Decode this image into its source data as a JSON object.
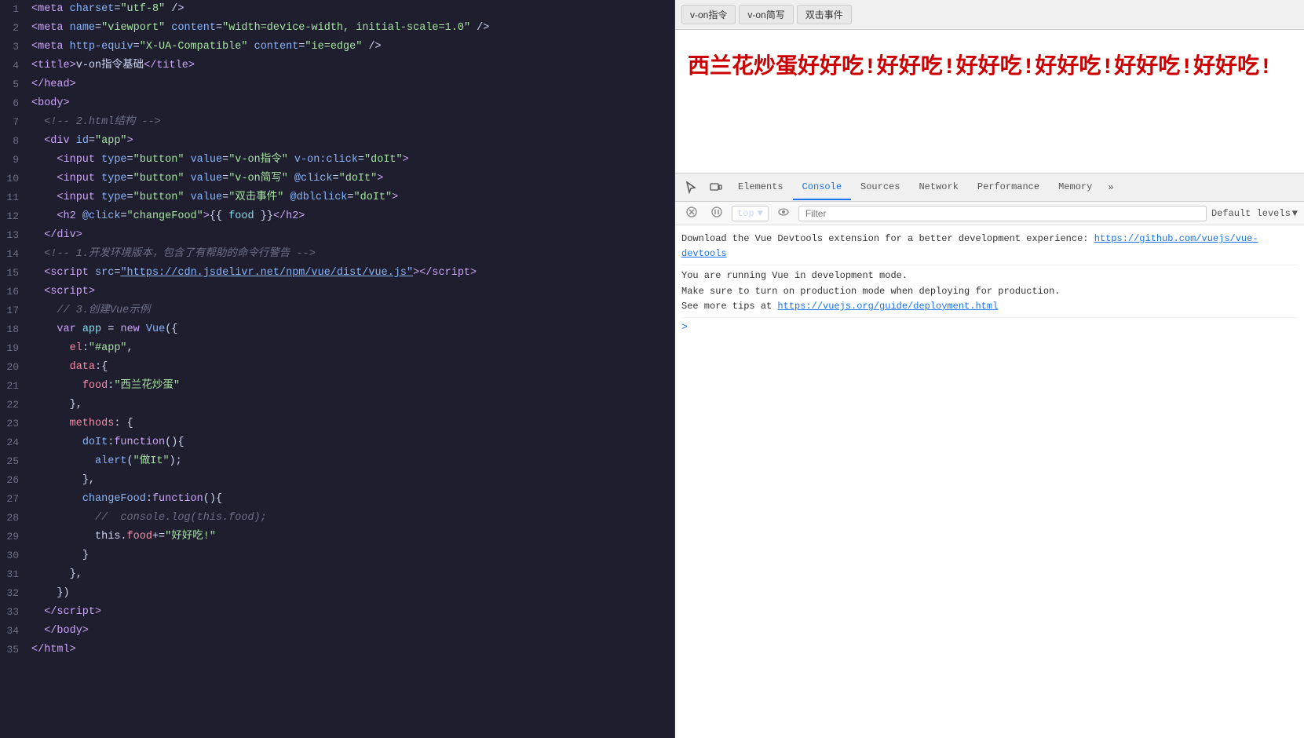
{
  "editor": {
    "lines": [
      {
        "num": 1,
        "html": "<span class='tag'>&lt;meta</span> <span class='attr-name'>charset</span><span class='punctuation'>=</span><span class='string'>\"utf-8\"</span> <span class='punctuation'>/&gt;</span>"
      },
      {
        "num": 2,
        "html": "<span class='tag'>&lt;meta</span> <span class='attr-name'>name</span><span class='punctuation'>=</span><span class='string'>\"viewport\"</span> <span class='attr-name'>content</span><span class='punctuation'>=</span><span class='string'>\"width=device-width, initial-scale=1.0\"</span> <span class='punctuation'>/&gt;</span>"
      },
      {
        "num": 3,
        "html": "<span class='tag'>&lt;meta</span> <span class='attr-name'>http-equiv</span><span class='punctuation'>=</span><span class='string'>\"X-UA-Compatible\"</span> <span class='attr-name'>content</span><span class='punctuation'>=</span><span class='string'>\"ie=edge\"</span> <span class='punctuation'>/&gt;</span>"
      },
      {
        "num": 4,
        "html": "<span class='tag'>&lt;title&gt;</span><span class='white'>v-on指令基础</span><span class='tag'>&lt;/title&gt;</span>"
      },
      {
        "num": 5,
        "html": "<span class='tag'>&lt;/head&gt;</span>"
      },
      {
        "num": 6,
        "html": "<span class='tag'>&lt;body&gt;</span>"
      },
      {
        "num": 7,
        "html": "  <span class='comment'>&lt;!-- 2.html结构 --&gt;</span>"
      },
      {
        "num": 8,
        "html": "  <span class='tag'>&lt;div</span> <span class='attr-name'>id</span><span class='punctuation'>=</span><span class='string'>\"app\"</span><span class='tag'>&gt;</span>"
      },
      {
        "num": 9,
        "html": "    <span class='tag'>&lt;input</span> <span class='attr-name'>type</span><span class='punctuation'>=</span><span class='string'>\"button\"</span> <span class='attr-name'>value</span><span class='punctuation'>=</span><span class='string'>\"v-on指令\"</span> <span class='attr-name'>v-on:click</span><span class='punctuation'>=</span><span class='string'>\"doIt\"</span><span class='tag'>&gt;</span>"
      },
      {
        "num": 10,
        "html": "    <span class='tag'>&lt;input</span> <span class='attr-name'>type</span><span class='punctuation'>=</span><span class='string'>\"button\"</span> <span class='attr-name'>value</span><span class='punctuation'>=</span><span class='string'>\"v-on简写\"</span> <span class='attr-name'>@click</span><span class='punctuation'>=</span><span class='string'>\"doIt\"</span><span class='tag'>&gt;</span>"
      },
      {
        "num": 11,
        "html": "    <span class='tag'>&lt;input</span> <span class='attr-name'>type</span><span class='punctuation'>=</span><span class='string'>\"button\"</span> <span class='attr-name'>value</span><span class='punctuation'>=</span><span class='string'>\"双击事件\"</span> <span class='attr-name'>@dblclick</span><span class='punctuation'>=</span><span class='string'>\"doIt\"</span><span class='tag'>&gt;</span>"
      },
      {
        "num": 12,
        "html": "    <span class='tag'>&lt;h2</span> <span class='attr-name'>@click</span><span class='punctuation'>=</span><span class='string'>\"changeFood\"</span><span class='tag'>&gt;</span><span class='punctuation'>{{</span> <span class='var-name'>food</span> <span class='punctuation'>}}</span><span class='tag'>&lt;/h2&gt;</span>"
      },
      {
        "num": 13,
        "html": "  <span class='tag'>&lt;/div&gt;</span>"
      },
      {
        "num": 14,
        "html": "  <span class='comment'>&lt;!-- 1.开发环境版本，包含了有帮助的命令行警告 --&gt;</span>"
      },
      {
        "num": 15,
        "html": "  <span class='tag'>&lt;script</span> <span class='attr-name'>src</span><span class='punctuation'>=</span><span class='link'>\"https://cdn.jsdelivr.net/npm/vue/dist/vue.js\"</span><span class='tag'>&gt;&lt;/script&gt;</span>"
      },
      {
        "num": 16,
        "html": "  <span class='tag'>&lt;script&gt;</span>"
      },
      {
        "num": 17,
        "html": "    <span class='comment'>// 3.创建Vue示例</span>"
      },
      {
        "num": 18,
        "html": "    <span class='keyword'>var</span> <span class='var-name'>app</span> <span class='punctuation'>=</span> <span class='keyword'>new</span> <span class='func-name'>Vue</span><span class='punctuation'>({</span>"
      },
      {
        "num": 19,
        "html": "      <span class='property'>el</span><span class='punctuation'>:</span><span class='string'>\"#app\"</span><span class='punctuation'>,</span>"
      },
      {
        "num": 20,
        "html": "      <span class='property'>data</span><span class='punctuation'>:{</span>"
      },
      {
        "num": 21,
        "html": "        <span class='property'>food</span><span class='punctuation'>:</span><span class='string'>\"西兰花炒蛋\"</span>"
      },
      {
        "num": 22,
        "html": "      <span class='punctuation'>},</span>"
      },
      {
        "num": 23,
        "html": "      <span class='property'>methods</span><span class='punctuation'>: {</span>"
      },
      {
        "num": 24,
        "html": "        <span class='func-name'>doIt</span><span class='punctuation'>:</span><span class='keyword'>function</span><span class='punctuation'>(){</span>"
      },
      {
        "num": 25,
        "html": "          <span class='func-name'>alert</span><span class='punctuation'>(</span><span class='string'>\"做It\"</span><span class='punctuation'>);</span>"
      },
      {
        "num": 26,
        "html": "        <span class='punctuation'>},</span>"
      },
      {
        "num": 27,
        "html": "        <span class='func-name'>changeFood</span><span class='punctuation'>:</span><span class='keyword'>function</span><span class='punctuation'>(){</span>"
      },
      {
        "num": 28,
        "html": "          <span class='comment'>//  console.log(this.food);</span>"
      },
      {
        "num": 29,
        "html": "          <span class='white'>this</span><span class='punctuation'>.</span><span class='property'>food</span><span class='punctuation'>+=</span><span class='string'>\"好好吃!\"</span>"
      },
      {
        "num": 30,
        "html": "        <span class='punctuation'>}</span>"
      },
      {
        "num": 31,
        "html": "      <span class='punctuation'>},</span>"
      },
      {
        "num": 32,
        "html": "    <span class='punctuation'>})</span>"
      },
      {
        "num": 33,
        "html": "  <span class='tag'>&lt;/script&gt;</span>"
      },
      {
        "num": 34,
        "html": "  <span class='tag'>&lt;/body&gt;</span>"
      },
      {
        "num": 35,
        "html": "<span class='tag'>&lt;/html&gt;</span>"
      }
    ]
  },
  "browser": {
    "buttons": [
      "v-on指令",
      "v-on简写",
      "双击事件"
    ],
    "page_text": "西兰花炒蛋好好吃!好好吃!好好吃!好好吃!好好吃!好好吃!"
  },
  "devtools": {
    "tabs": [
      "Elements",
      "Console",
      "Sources",
      "Network",
      "Performance",
      "Memory"
    ],
    "active_tab": "Console",
    "console_context": "top",
    "filter_placeholder": "Filter",
    "filter_level": "Default levels",
    "messages": [
      {
        "text": "Download the Vue Devtools extension for a better development experience:",
        "link": "https://github.com/vuejs/vue-devtools",
        "link_url": "https://github.com/vuejs/vue-devtools"
      },
      {
        "text": "You are running Vue in development mode.\nMake sure to turn on production mode when deploying for production.\nSee more tips at ",
        "link": "https://vuejs.org/guide/deployment.html",
        "link_url": "https://vuejs.org/guide/deployment.html"
      }
    ],
    "prompt": ">"
  }
}
